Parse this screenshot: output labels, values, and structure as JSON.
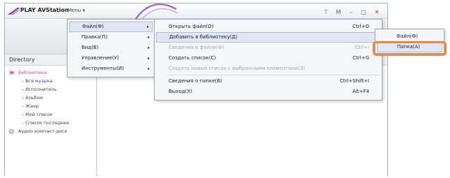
{
  "app": {
    "title": "PLAY AVStation",
    "menu_label": "Menu",
    "menu_chevron": "▾",
    "window_buttons": {
      "filter": "⊤",
      "mini": "M",
      "minimize": "–",
      "maximize": "□",
      "close": "✕"
    }
  },
  "sidebar": {
    "header": "Directory",
    "root": "Библиотека",
    "items": [
      "Вся музыка",
      "Исполнитель",
      "Альбом",
      "Жанр",
      "Мой список",
      "Список последних"
    ],
    "disc": "Аудио компакт-диск"
  },
  "main_menu": {
    "items": [
      {
        "label": "Файл(Ф)",
        "arrow": "▸"
      },
      {
        "label": "Правка(П)",
        "arrow": "▸"
      },
      {
        "label": "Вид(В)",
        "arrow": "▸"
      },
      {
        "label": "Управление(У)",
        "arrow": "▸"
      },
      {
        "label": "Инструменты(И)",
        "arrow": "▸"
      }
    ]
  },
  "file_menu": {
    "items": [
      {
        "label": "Открыть файл(О)",
        "shortcut": "Ctrl+O"
      },
      {
        "label": "Добавить в библиотеку(Д)",
        "shortcut": "",
        "arrow": "▸"
      },
      {
        "label": "Сведения о файле(Ф)",
        "shortcut": "Ctrl+I"
      },
      {
        "label": "Создать список(С)",
        "shortcut": "Ctrl+G"
      },
      {
        "label": "Создать новый список с выбранными элементами(Э)",
        "shortcut": ""
      },
      {
        "label": "Сведения о папке(В)",
        "shortcut": "Ctrl+Shift+I"
      },
      {
        "label": "Выход(Х)",
        "shortcut": "Alt+F4"
      }
    ]
  },
  "add_submenu": {
    "items": [
      {
        "label": "Файл(Ф)"
      },
      {
        "label": "Папка(А)"
      }
    ]
  },
  "colors": {
    "accent_purple": "#7b3fa0",
    "callout_orange": "#f0883a",
    "menu_highlight": "#dfe7f5"
  }
}
